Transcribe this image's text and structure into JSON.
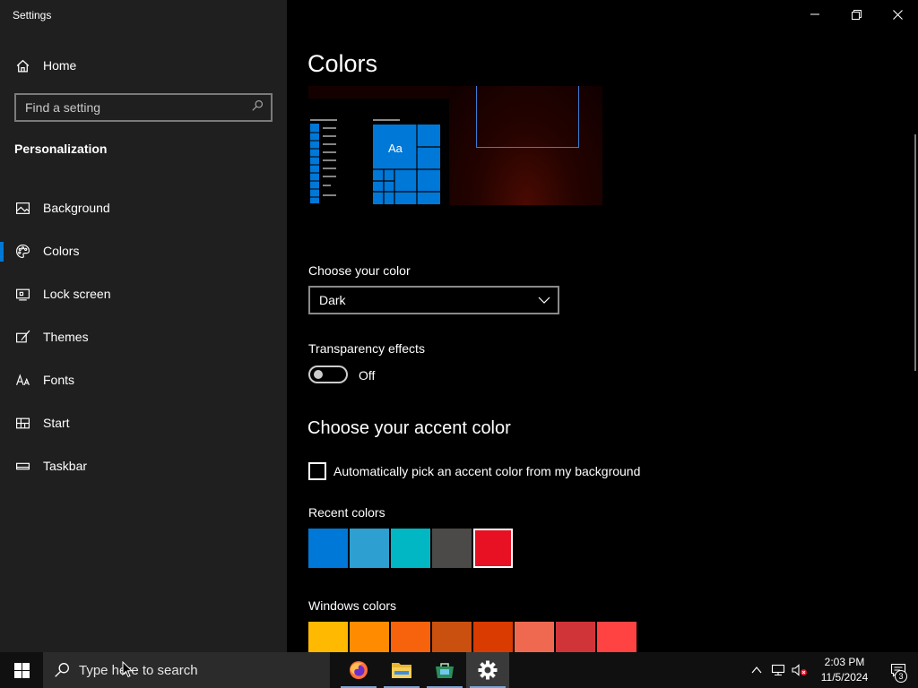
{
  "window": {
    "title": "Settings"
  },
  "sidebar": {
    "home_label": "Home",
    "search_placeholder": "Find a setting",
    "section": "Personalization",
    "items": [
      {
        "label": "Background",
        "icon": "image-icon",
        "active": false
      },
      {
        "label": "Colors",
        "icon": "palette-icon",
        "active": true
      },
      {
        "label": "Lock screen",
        "icon": "lock-screen-icon",
        "active": false
      },
      {
        "label": "Themes",
        "icon": "brush-icon",
        "active": false
      },
      {
        "label": "Fonts",
        "icon": "font-icon",
        "active": false
      },
      {
        "label": "Start",
        "icon": "start-icon",
        "active": false
      },
      {
        "label": "Taskbar",
        "icon": "taskbar-icon",
        "active": false
      }
    ]
  },
  "main": {
    "title": "Colors",
    "preview": {
      "tile_text": "Aa"
    },
    "choose_color": {
      "label": "Choose your color",
      "value": "Dark"
    },
    "transparency": {
      "label": "Transparency effects",
      "state": "Off"
    },
    "accent": {
      "heading": "Choose your accent color",
      "auto_pick_label": "Automatically pick an accent color from my background",
      "recent_label": "Recent colors",
      "recent_colors": [
        "#0078d7",
        "#2d9fd0",
        "#00b7c3",
        "#4c4a48",
        "#e81123"
      ],
      "selected_recent": 4,
      "windows_label": "Windows colors",
      "windows_colors": [
        "#ffb900",
        "#ff8c00",
        "#f7630c",
        "#ca5010",
        "#da3b01",
        "#ef6950",
        "#d13438",
        "#ff4343"
      ]
    }
  },
  "taskbar": {
    "search_placeholder": "Type here to search",
    "apps": [
      "firefox-icon",
      "file-explorer-icon",
      "store-icon",
      "settings-icon"
    ],
    "time": "2:03 PM",
    "date": "11/5/2024",
    "notification_count": "3"
  }
}
